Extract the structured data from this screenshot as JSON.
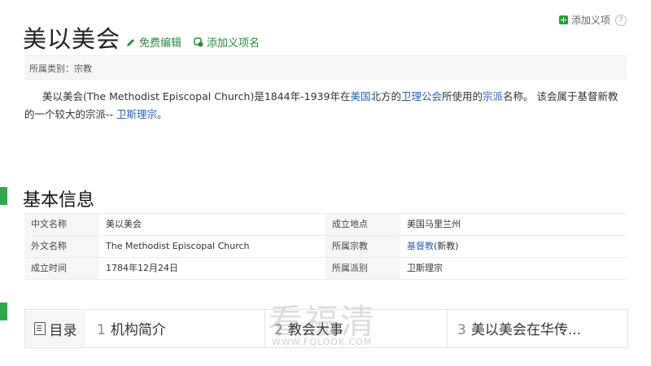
{
  "header": {
    "top_right_add": "添加义项",
    "help": "?",
    "title": "美以美会",
    "edit_label": "免费编辑",
    "add_name_label": "添加义项名"
  },
  "category": {
    "text": "所属类别：宗教"
  },
  "summary": {
    "text1": "美以美会(The Methodist Episcopal Church)是1844年-1939年在",
    "link1": "美国",
    "text2": "北方的",
    "link2": "卫理公会",
    "text3": "所使用的",
    "link3": "宗派",
    "text4": "名称。 该会属于基督新教的一个较大的宗派-- ",
    "link4": "卫斯理宗",
    "text5": "。"
  },
  "basic_info": {
    "title": "基本信息",
    "rows": [
      {
        "l1": "中文名称",
        "v1": "美以美会",
        "l2": "成立地点",
        "v2": "美国马里兰州"
      },
      {
        "l1": "外文名称",
        "v1": "The Methodist Episcopal Church",
        "l2": "所属宗教",
        "v2_link": "基督教",
        "v2_rest": "(新教)"
      },
      {
        "l1": "成立时间",
        "v1": "1784年12月24日",
        "l2": "所属派别",
        "v2": "卫斯理宗"
      }
    ]
  },
  "toc": {
    "header": "目录",
    "items": [
      {
        "num": "1",
        "label": "机构简介"
      },
      {
        "num": "2",
        "label": "教会大事"
      },
      {
        "num": "3",
        "label": "美以美会在华传..."
      }
    ]
  },
  "watermark": {
    "text": "看福清",
    "url": "WWW.FQLOOK.COM"
  },
  "colors": {
    "accent_green": "#2ea84a",
    "link_blue": "#2a62b0"
  }
}
